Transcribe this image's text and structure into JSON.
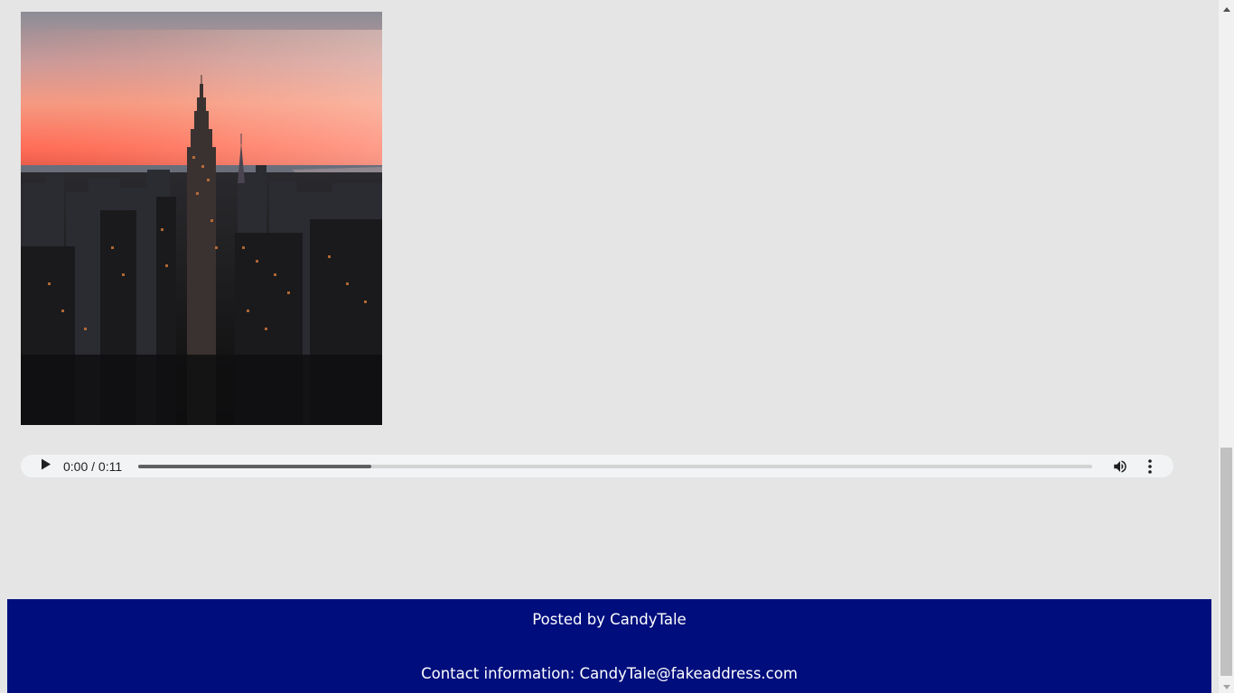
{
  "photo": {
    "alt": "City skyline at sunset"
  },
  "audio": {
    "current_time": "0:00",
    "separator": "/",
    "duration": "0:11",
    "time_display": "0:00 / 0:11",
    "buffered_fraction": 0.244,
    "icons": {
      "play": "play-icon",
      "volume": "volume-icon",
      "more": "more-options-icon"
    }
  },
  "footer": {
    "posted_by": "Posted by CandyTale",
    "contact": "Contact information: CandyTale@fakeaddress.com",
    "background_color": "#000e7d",
    "text_color": "#ffffff"
  },
  "scrollbar": {
    "scroll_fraction": 1.0
  }
}
